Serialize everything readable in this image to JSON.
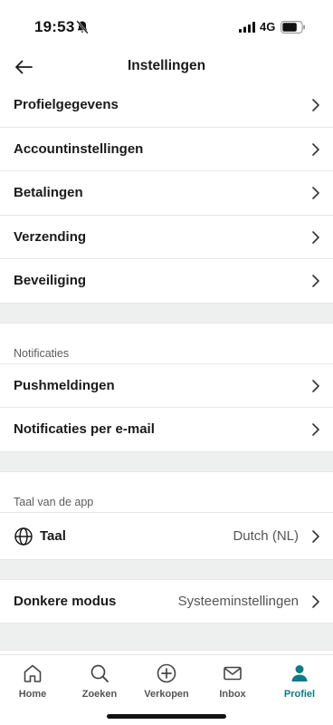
{
  "status_bar": {
    "time": "19:53",
    "network": "4G"
  },
  "header": {
    "title": "Instellingen"
  },
  "account_section": {
    "items": [
      {
        "label": "Profielgegevens"
      },
      {
        "label": "Accountinstellingen"
      },
      {
        "label": "Betalingen"
      },
      {
        "label": "Verzending"
      },
      {
        "label": "Beveiliging"
      }
    ]
  },
  "notifications_section": {
    "title": "Notificaties",
    "items": [
      {
        "label": "Pushmeldingen"
      },
      {
        "label": "Notificaties per e-mail"
      }
    ]
  },
  "language_section": {
    "title": "Taal van de app",
    "item": {
      "label": "Taal",
      "value": "Dutch (NL)"
    }
  },
  "dark_mode": {
    "label": "Donkere modus",
    "value": "Systeeminstellingen"
  },
  "tabbar": {
    "tabs": [
      {
        "label": "Home"
      },
      {
        "label": "Zoeken"
      },
      {
        "label": "Verkopen"
      },
      {
        "label": "Inbox"
      },
      {
        "label": "Profiel"
      }
    ]
  },
  "colors": {
    "accent": "#0a7c86",
    "divider_band": "#eef0f0"
  }
}
